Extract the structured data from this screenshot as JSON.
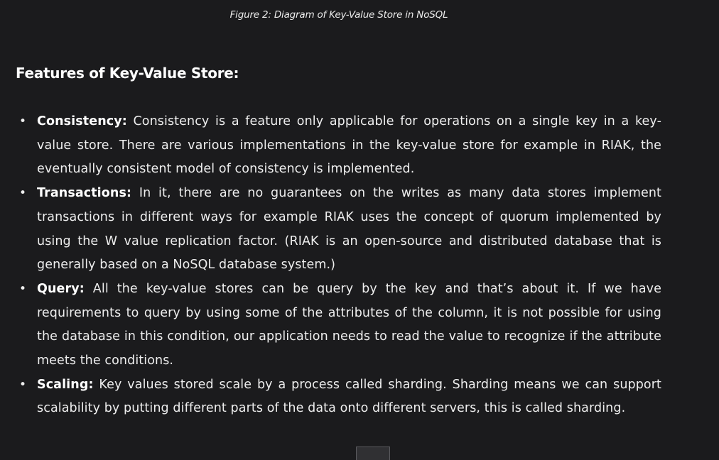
{
  "caption": "Figure 2: Diagram of Key-Value Store in NoSQL",
  "heading": "Features of Key-Value Store:",
  "features": [
    {
      "term": "Consistency:",
      "text": " Consistency is a feature only applicable for operations on a single key in a key-value store. There are various implementations in the key-value store for example in RIAK, the eventually consistent model of consistency is implemented."
    },
    {
      "term": "Transactions:",
      "text": " In it, there are no guarantees on the writes as many data stores implement transactions in different ways for example RIAK uses the concept of quorum implemented by using the W value replication factor. (RIAK is an open-source and distributed database that is generally based on a NoSQL database system.)"
    },
    {
      "term": "Query:",
      "text": " All the key-value stores can be query by the key and that’s about it. If we have requirements to query by using some of the attributes of the column, it is not possible for using the database in this condition,  our application needs to read the value to recognize if the attribute meets the conditions."
    },
    {
      "term": "Scaling:",
      "text": " Key values stored scale by a process called sharding. Sharding means we can support scalability by putting different parts of the data onto different servers, this is called sharding."
    }
  ]
}
